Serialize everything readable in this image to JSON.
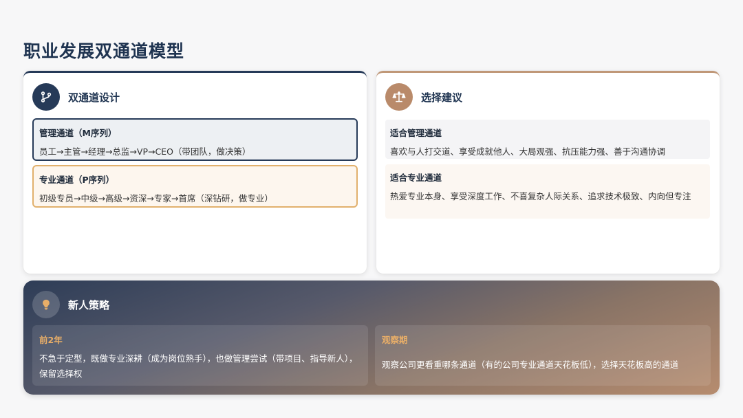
{
  "page": {
    "title": "职业发展双通道模型"
  },
  "dual_track": {
    "title": "双通道设计",
    "icon": "branch-icon",
    "management": {
      "title": "管理通道（M序列）",
      "path": "员工→主管→经理→总监→VP→CEO（带团队，做决策）"
    },
    "professional": {
      "title": "专业通道（P序列）",
      "path": "初级专员→中级→高级→资深→专家→首席（深钻研，做专业）"
    }
  },
  "advice": {
    "title": "选择建议",
    "icon": "balance-scale-icon",
    "management": {
      "title": "适合管理通道",
      "desc": "喜欢与人打交道、享受成就他人、大局观强、抗压能力强、善于沟通协调"
    },
    "professional": {
      "title": "适合专业通道",
      "desc": "热爱专业本身、享受深度工作、不喜复杂人际关系、追求技术极致、内向但专注"
    }
  },
  "strategy": {
    "title": "新人策略",
    "icon": "lightbulb-icon",
    "stage1": {
      "title": "前2年",
      "desc": "不急于定型，既做专业深耕（成为岗位熟手），也做管理尝试（带项目、指导新人），保留选择权"
    },
    "stage2": {
      "title": "观察期",
      "desc": "观察公司更看重哪条通道（有的公司专业通道天花板低），选择天花板高的通道"
    }
  },
  "colors": {
    "navy": "#263a58",
    "bronze": "#c09878",
    "gold": "#e1b06c"
  }
}
